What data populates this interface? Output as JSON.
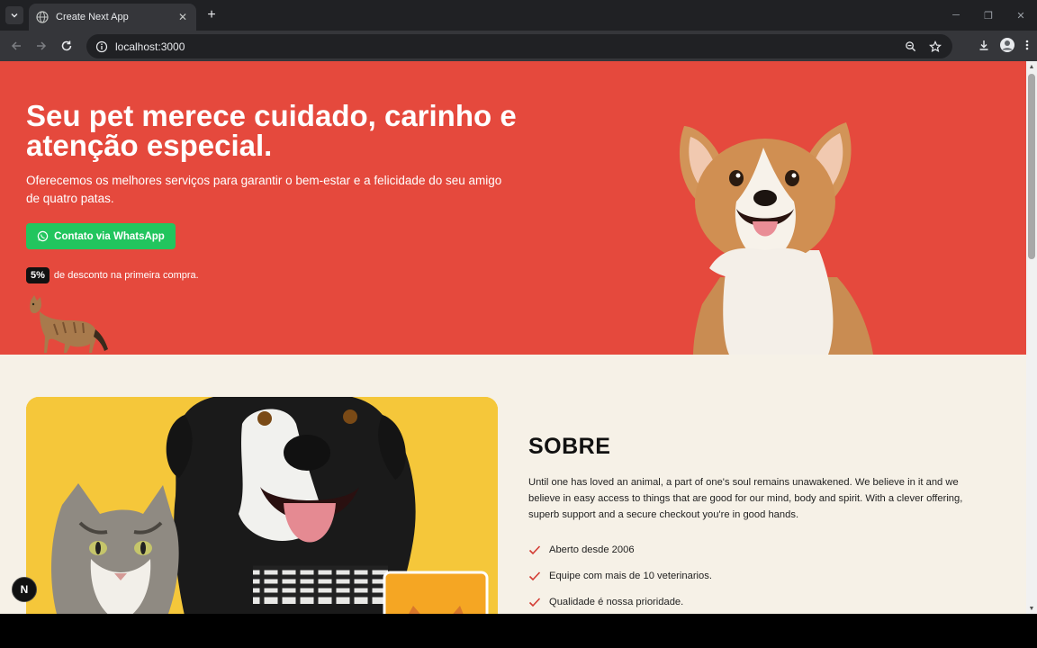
{
  "browser": {
    "tab_title": "Create Next App",
    "url": "localhost:3000"
  },
  "hero": {
    "title": "Seu pet merece cuidado, carinho e atenção especial.",
    "subtitle": "Oferecemos os melhores serviços para garantir o bem-estar e a felicidade do seu amigo de quatro patas.",
    "cta_label": "Contato via WhatsApp",
    "discount_badge": "5%",
    "discount_text": "de desconto na primeira compra.",
    "background_color": "#e5493d",
    "cta_color": "#22c55e"
  },
  "about": {
    "title": "SOBRE",
    "text": "Until one has loved an animal, a part of one's soul remains unawakened. We believe in it and we believe in easy access to things that are good for our mind, body and spirit. With a clever offering, superb support and a secure checkout you're in good hands.",
    "items": [
      {
        "label": "Aberto desde 2006"
      },
      {
        "label": "Equipe com mais de 10 veterinarios."
      },
      {
        "label": "Qualidade é nossa prioridade."
      }
    ],
    "background_color": "#f6f1e7"
  },
  "dev_badge": {
    "label": "N"
  }
}
